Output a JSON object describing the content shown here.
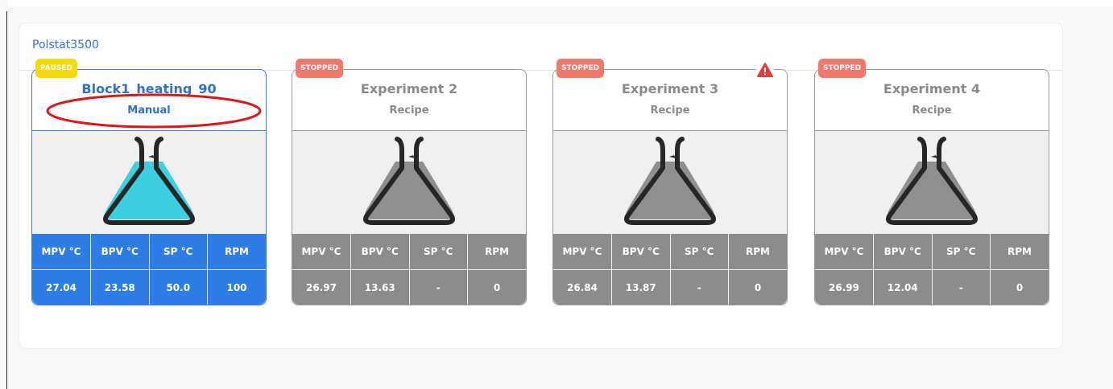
{
  "panel": {
    "title": "Polstat3500"
  },
  "colors": {
    "accent_blue": "#2e7ce6",
    "stopped_badge": "#f1786c",
    "paused_badge": "#f5d90a",
    "inactive_gray": "#8c8c8c",
    "liquid_active": "#3bcfe0",
    "liquid_inactive": "#8f8f8f",
    "warning_red": "#e43b3b",
    "annotation_red": "#e01515"
  },
  "stats_headers": [
    "MPV °C",
    "BPV °C",
    "SP °C",
    "RPM"
  ],
  "cards": [
    {
      "status": "PAUSED",
      "name": "Block1_heating_90",
      "mode": "Manual",
      "icon": "flask-icon",
      "values": [
        "27.04",
        "23.58",
        "50.0",
        "100"
      ]
    },
    {
      "status": "STOPPED",
      "name": "Experiment 2",
      "mode": "Recipe",
      "icon": "flask-icon",
      "values": [
        "26.97",
        "13.63",
        "-",
        "0"
      ]
    },
    {
      "status": "STOPPED",
      "name": "Experiment 3",
      "mode": "Recipe",
      "icon": "flask-icon",
      "warning_icon": "warning-icon",
      "values": [
        "26.84",
        "13.87",
        "-",
        "0"
      ]
    },
    {
      "status": "STOPPED",
      "name": "Experiment 4",
      "mode": "Recipe",
      "icon": "flask-icon",
      "values": [
        "26.99",
        "12.04",
        "-",
        "0"
      ]
    }
  ]
}
